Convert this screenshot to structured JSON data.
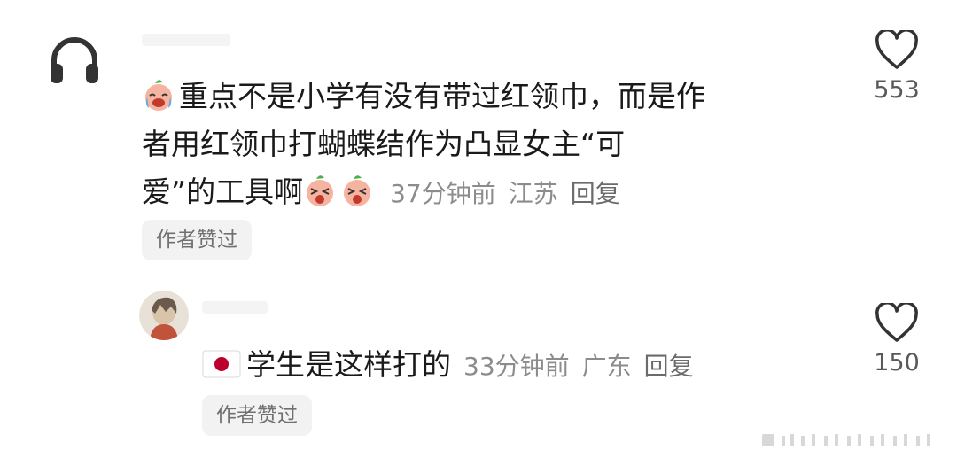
{
  "comment": {
    "text": "重点不是小学有没有带过红领巾，而是作者用红领巾打蝴蝶结作为凸显女主“可爱”的工具啊",
    "line1": "重点不是小学有没有带过红领巾，而是作",
    "line2": "者用红领巾打蝴蝶结作为凸显女主“可",
    "line3": "爱”的工具啊",
    "time": "37分钟前",
    "location": "江苏",
    "reply_label": "回复",
    "author_liked": "作者赞过",
    "like_count": "553",
    "leading_icon": "crying-laughing-emoji",
    "trailing_icons": [
      "shocked-emoji",
      "shocked-emoji"
    ]
  },
  "reply": {
    "text": "学生是这样打的",
    "time": "33分钟前",
    "location": "广东",
    "reply_label": "回复",
    "author_liked": "作者赞过",
    "like_count": "150",
    "leading_icon": "japan-flag"
  },
  "colors": {
    "text": "#1a1a1a",
    "meta": "#8c8c8c",
    "badge_bg": "#f2f2f2",
    "flag_red": "#bc002d"
  }
}
